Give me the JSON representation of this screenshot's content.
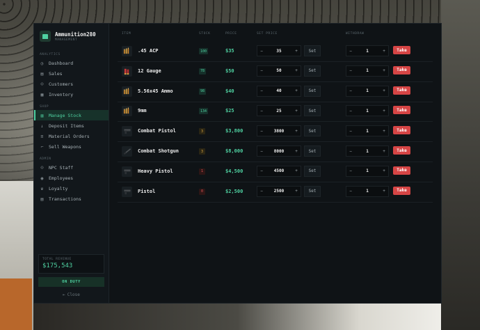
{
  "app": {
    "title": "Ammunition280",
    "subtitle": "MANAGEMENT"
  },
  "sidebar": {
    "sections": [
      {
        "label": "ANALYTICS",
        "items": [
          {
            "label": "Dashboard",
            "icon": "dashboard-icon"
          },
          {
            "label": "Sales",
            "icon": "sales-icon"
          },
          {
            "label": "Customers",
            "icon": "customers-icon"
          },
          {
            "label": "Inventory",
            "icon": "inventory-icon"
          }
        ]
      },
      {
        "label": "SHOP",
        "items": [
          {
            "label": "Manage Stock",
            "icon": "manage-stock-icon",
            "active": true
          },
          {
            "label": "Deposit Items",
            "icon": "deposit-icon"
          },
          {
            "label": "Material Orders",
            "icon": "orders-icon"
          },
          {
            "label": "Sell Weapons",
            "icon": "sell-icon"
          }
        ]
      },
      {
        "label": "ADMIN",
        "items": [
          {
            "label": "NPC Staff",
            "icon": "npc-icon"
          },
          {
            "label": "Employees",
            "icon": "employees-icon"
          },
          {
            "label": "Loyalty",
            "icon": "loyalty-icon"
          },
          {
            "label": "Transactions",
            "icon": "transactions-icon"
          }
        ]
      }
    ],
    "revenue_label": "TOTAL REVENUE",
    "revenue_value": "$175,543",
    "duty_label": "ON DUTY",
    "close_label": "Close"
  },
  "table": {
    "headers": {
      "item": "ITEM",
      "stock": "STOCK",
      "price": "PRICE",
      "set_price": "SET PRICE",
      "withdraw": "WITHDRAW"
    },
    "rows": [
      {
        "name": ".45 ACP",
        "stock": "100",
        "stock_level": "good",
        "price": "$35",
        "set_value": "35",
        "qty": "1",
        "icon": "ammo-icon"
      },
      {
        "name": "12 Gauge",
        "stock": "78",
        "stock_level": "good",
        "price": "$50",
        "set_value": "50",
        "qty": "1",
        "icon": "shell-icon"
      },
      {
        "name": "5.56x45 Ammo",
        "stock": "98",
        "stock_level": "good",
        "price": "$40",
        "set_value": "40",
        "qty": "1",
        "icon": "ammo-icon"
      },
      {
        "name": "9mm",
        "stock": "134",
        "stock_level": "good",
        "price": "$25",
        "set_value": "25",
        "qty": "1",
        "icon": "ammo-icon"
      },
      {
        "name": "Combat Pistol",
        "stock": "3",
        "stock_level": "low",
        "price": "$3,800",
        "set_value": "3800",
        "qty": "1",
        "icon": "pistol-icon"
      },
      {
        "name": "Combat Shotgun",
        "stock": "3",
        "stock_level": "low",
        "price": "$8,000",
        "set_value": "8000",
        "qty": "1",
        "icon": "shotgun-icon"
      },
      {
        "name": "Heavy Pistol",
        "stock": "1",
        "stock_level": "critical",
        "price": "$4,500",
        "set_value": "4500",
        "qty": "1",
        "icon": "pistol-icon"
      },
      {
        "name": "Pistol",
        "stock": "0",
        "stock_level": "critical",
        "price": "$2,500",
        "set_value": "2500",
        "qty": "1",
        "icon": "pistol-icon"
      }
    ],
    "set_label": "Set",
    "take_label": "Take",
    "minus": "−",
    "plus": "+"
  },
  "colors": {
    "accent": "#4fd1a1",
    "danger": "#d64545",
    "warning": "#d9a441",
    "panel": "#0f1316"
  }
}
